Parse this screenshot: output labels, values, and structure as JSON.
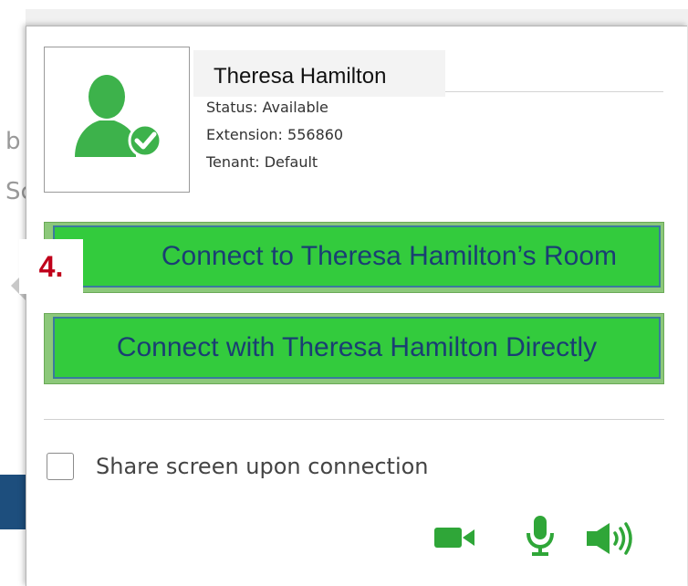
{
  "background": {
    "fragments": [
      "b",
      "Sc"
    ]
  },
  "contact": {
    "name": "Theresa Hamilton",
    "status": "Status: Available",
    "extension": "Extension: 556860",
    "tenant": "Tenant: Default",
    "avatar_icon": "user-available-icon"
  },
  "annotation": {
    "step": "4."
  },
  "actions": {
    "connect_room_label": "Connect to Theresa Hamilton’s Room",
    "connect_direct_label": "Connect with Theresa Hamilton Directly"
  },
  "options": {
    "share_screen_label": "Share screen upon connection",
    "share_screen_checked": false
  },
  "devices": {
    "icons": [
      "camera-icon",
      "microphone-icon",
      "speaker-icon"
    ],
    "color": "#2fa638"
  },
  "colors": {
    "button_fill": "#33cb3d",
    "button_text": "#1a3e73",
    "step_label": "#c0001a",
    "avatar_green": "#3db24b"
  }
}
